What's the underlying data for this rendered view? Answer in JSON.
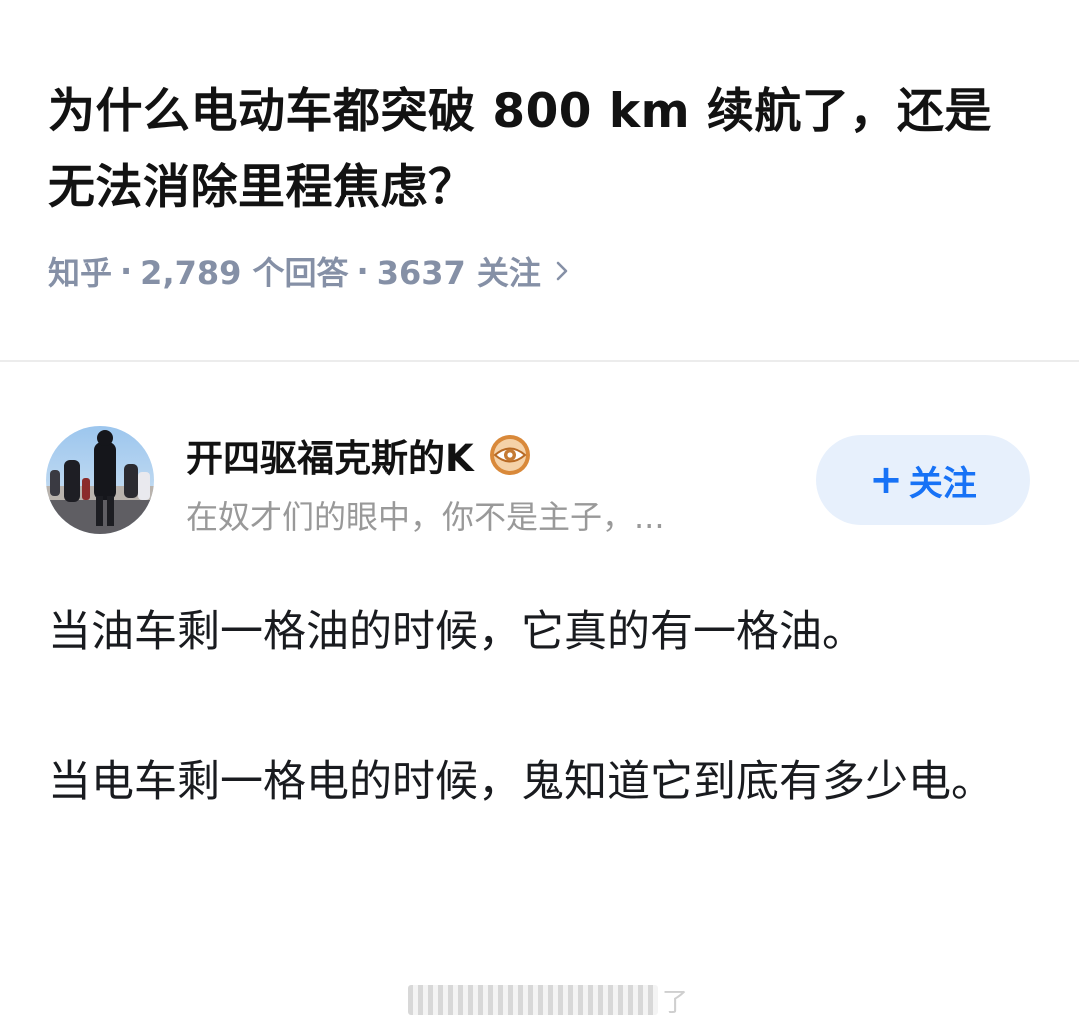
{
  "question": {
    "title": "为什么电动车都突破 800 km 续航了，还是无法消除里程焦虑？",
    "source": "知乎",
    "answer_count": "2,789 个回答",
    "follow_count": "3637 关注",
    "separator": "·"
  },
  "author": {
    "name": "开四驱福克斯的K",
    "bio": "在奴才们的眼中，你不是主子，...",
    "badge_icon": "eye-badge-icon",
    "follow_button": {
      "plus": "+",
      "label": "关注"
    }
  },
  "answer": {
    "paragraphs": [
      "当油车剩一格油的时候，它真的有一格油。",
      "当电车剩一格电的时候，鬼知道它到底有多少电。"
    ]
  },
  "watermark": {
    "tail": "了"
  },
  "colors": {
    "accent": "#1772f6",
    "follow_bg": "#e7f0fc",
    "meta_text": "#8590a6",
    "bio_text": "#999999",
    "badge": "#d9893a"
  }
}
